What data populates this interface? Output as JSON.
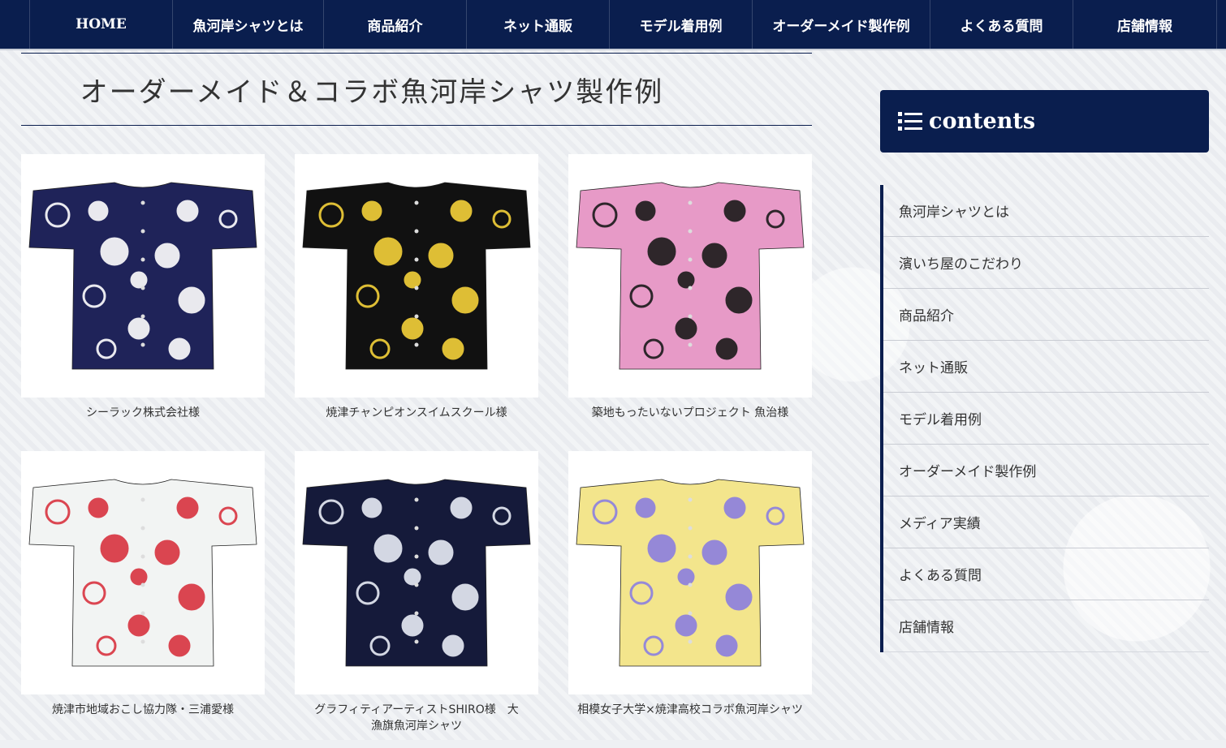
{
  "nav": {
    "items": [
      "HOME",
      "魚河岸シャツとは",
      "商品紹介",
      "ネット通販",
      "モデル着用例",
      "オーダーメイド製作例",
      "よくある質問",
      "店舗情報"
    ]
  },
  "main": {
    "title": "オーダーメイド＆コラボ魚河岸シャツ製作例",
    "products": [
      {
        "caption": "シーラック株式会社様",
        "colors": {
          "shirt": "#1f2359",
          "print": "#ffffff"
        }
      },
      {
        "caption": "焼津チャンピオンスイムスクール様",
        "colors": {
          "shirt": "#111111",
          "print": "#f5d13a"
        }
      },
      {
        "caption": "築地もったいないプロジェクト 魚治様",
        "colors": {
          "shirt": "#e79ac7",
          "print": "#1a1a1a"
        }
      },
      {
        "caption": "焼津市地域おこし協力隊・三浦愛様",
        "colors": {
          "shirt": "#f2f4f3",
          "print": "#d8333f"
        }
      },
      {
        "caption": "グラフィティアーティストSHIRO様　大漁旗魚河岸シャツ",
        "colors": {
          "shirt": "#151a3a",
          "print": "#e8ecf6"
        }
      },
      {
        "caption": "相模女子大学×焼津高校コラボ魚河岸シャツ",
        "colors": {
          "shirt": "#f3e58c",
          "print": "#8b7ee0"
        }
      }
    ]
  },
  "sidebar": {
    "header": "contents",
    "items": [
      "魚河岸シャツとは",
      "濱いち屋のこだわり",
      "商品紹介",
      "ネット通販",
      "モデル着用例",
      "オーダーメイド製作例",
      "メディア実績",
      "よくある質問",
      "店舗情報"
    ]
  },
  "colors": {
    "navy": "#0a1e4e"
  },
  "icons": {
    "contents": "list-icon"
  }
}
